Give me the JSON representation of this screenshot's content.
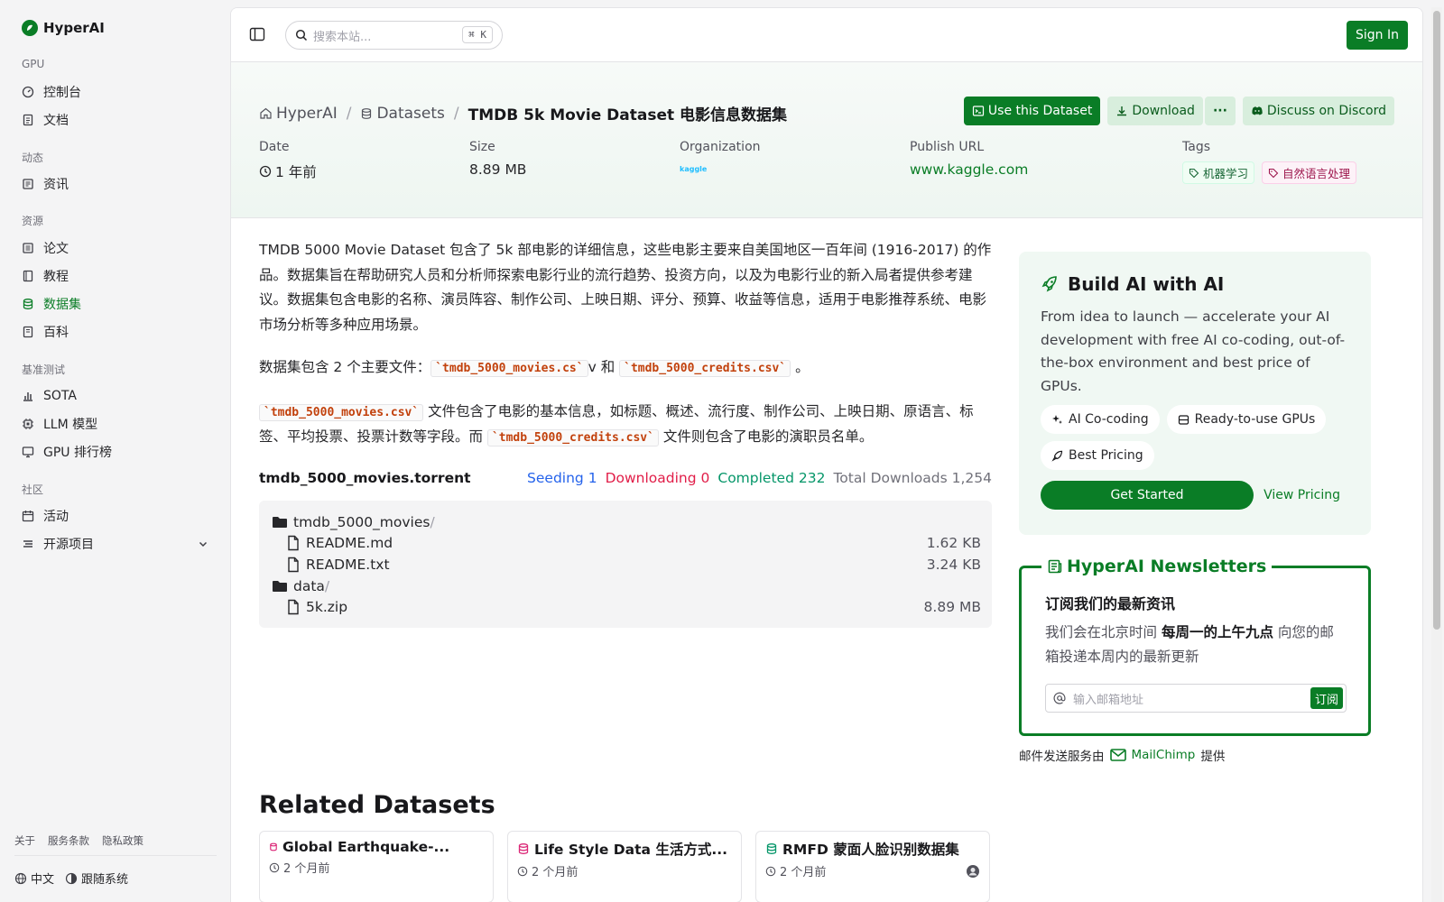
{
  "sidebar": {
    "brand": "HyperAI",
    "sections": [
      {
        "title": "GPU",
        "items": [
          "控制台",
          "文档"
        ]
      },
      {
        "title": "动态",
        "items": [
          "资讯"
        ]
      },
      {
        "title": "资源",
        "items": [
          "论文",
          "教程",
          "数据集",
          "百科"
        ]
      },
      {
        "title": "基准测试",
        "items": [
          "SOTA",
          "LLM 模型",
          "GPU 排行榜"
        ]
      },
      {
        "title": "社区",
        "items": [
          "活动",
          "开源项目"
        ]
      }
    ],
    "footer_links": [
      "关于",
      "服务条款",
      "隐私政策"
    ],
    "language": "中文",
    "theme": "跟随系统"
  },
  "topbar": {
    "search_placeholder": "搜索本站...",
    "shortcut": "⌘ K",
    "signin": "Sign In"
  },
  "header": {
    "crumbs": [
      "HyperAI",
      "Datasets",
      "TMDB 5k Movie Dataset 电影信息数据集"
    ],
    "buttons": {
      "use": "Use this Dataset",
      "download": "Download",
      "more": "···",
      "discord": "Discuss on Discord"
    },
    "meta": {
      "date_label": "Date",
      "date_value": "1 年前",
      "size_label": "Size",
      "size_value": "8.89 MB",
      "org_label": "Organization",
      "org_logo": "kaggle",
      "url_label": "Publish URL",
      "url_value": "www.kaggle.com",
      "tags_label": "Tags",
      "tags": [
        "机器学习",
        "自然语言处理"
      ]
    }
  },
  "content": {
    "p1": "TMDB 5000 Movie Dataset 包含了 5k 部电影的详细信息，这些电影主要来自美国地区一百年间 (1916-2017) 的作品。数据集旨在帮助研究人员和分析师探索电影行业的流行趋势、投资方向，以及为电影行业的新入局者提供参考建议。数据集包含电影的名称、演员阵容、制作公司、上映日期、评分、预算、收益等信息，适用于电影推荐系统、电影市场分析等多种应用场景。",
    "p2_a": "数据集包含 2 个主要文件：",
    "p2_code1": "`tmdb_5000_movies.cs`",
    "p2_b": "v 和 ",
    "p2_code2": "`tmdb_5000_credits.csv`",
    "p2_c": " 。",
    "p3_code1": "`tmdb_5000_movies.csv`",
    "p3_a": " 文件包含了电影的基本信息，如标题、概述、流行度、制作公司、上映日期、原语言、标签、平均投票、投票计数等字段。而 ",
    "p3_code2": "`tmdb_5000_credits.csv`",
    "p3_b": " 文件则包含了电影的演职员名单。"
  },
  "torrent": {
    "name": "tmdb_5000_movies.torrent",
    "seeding": "Seeding 1",
    "downloading": "Downloading 0",
    "completed": "Completed 232",
    "total": "Total Downloads 1,254",
    "files": [
      {
        "name": "tmdb_5000_movies",
        "slash": "/",
        "size": "",
        "type": "folder",
        "indent": false
      },
      {
        "name": "README.md",
        "slash": "",
        "size": "1.62 KB",
        "type": "file",
        "indent": true
      },
      {
        "name": "README.txt",
        "slash": "",
        "size": "3.24 KB",
        "type": "file",
        "indent": true
      },
      {
        "name": "data",
        "slash": "/",
        "size": "",
        "type": "folder",
        "indent": false
      },
      {
        "name": "5k.zip",
        "slash": "",
        "size": "8.89 MB",
        "type": "file",
        "indent": true
      }
    ]
  },
  "build": {
    "title": "Build AI with AI",
    "desc": "From idea to launch — accelerate your AI development with free AI co-coding, out-of-the-box environment and best price of GPUs.",
    "chips": [
      "AI Co-coding",
      "Ready-to-use GPUs",
      "Best Pricing"
    ],
    "cta": "Get Started",
    "pricing": "View Pricing"
  },
  "newsletter": {
    "legend": "HyperAI Newsletters",
    "title": "订阅我们的最新资讯",
    "text_a": "我们会在北京时间 ",
    "text_bold": "每周一的上午九点",
    "text_b": " 向您的邮箱投递本周内的最新更新",
    "placeholder": "输入邮箱地址",
    "submit": "订阅",
    "provider_a": "邮件发送服务由",
    "provider_name": "MailChimp",
    "provider_b": "提供"
  },
  "related": {
    "title": "Related Datasets",
    "cards": [
      {
        "title": "Global Earthquake-...",
        "date": "2 个月前"
      },
      {
        "title": "Life Style Data 生活方式...",
        "date": "2 个月前"
      },
      {
        "title": "RMFD 蒙面人脸识别数据集",
        "date": "2 个月前"
      }
    ]
  },
  "colors": {
    "brand": "#0a7d26",
    "seeding": "#2563eb",
    "downloading": "#e11d48",
    "completed": "#059669"
  }
}
